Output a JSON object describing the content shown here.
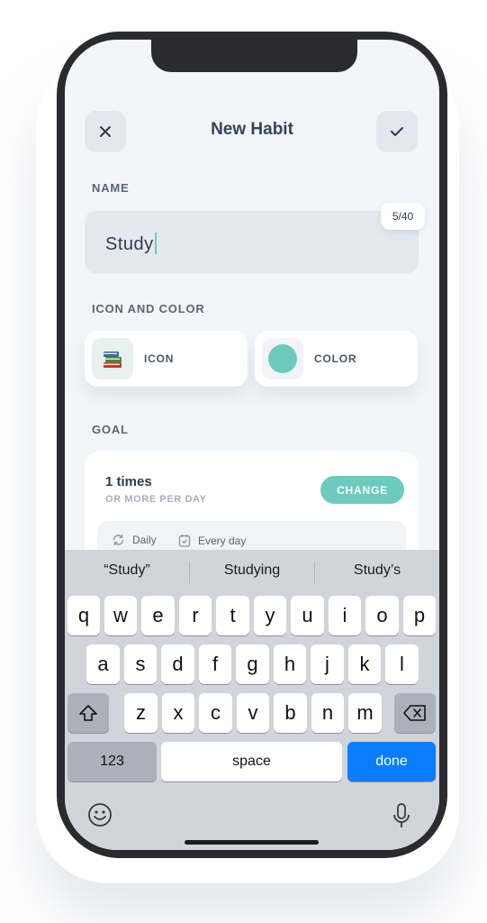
{
  "header": {
    "title": "New Habit"
  },
  "name_section": {
    "label": "NAME",
    "value": "Study",
    "counter": "5/40"
  },
  "icon_color_section": {
    "label": "ICON AND COLOR",
    "icon_label": "ICON",
    "color_label": "COLOR",
    "selected_color": "#6ccbbd",
    "selected_icon": "books-icon"
  },
  "goal_section": {
    "label": "GOAL",
    "times": "1 times",
    "subtitle": "OR MORE PER DAY",
    "change_label": "CHANGE",
    "frequency": "Daily",
    "schedule": "Every day"
  },
  "keyboard": {
    "suggestions": [
      "“Study”",
      "Studying",
      "Study’s"
    ],
    "row1": [
      "q",
      "w",
      "e",
      "r",
      "t",
      "y",
      "u",
      "i",
      "o",
      "p"
    ],
    "row2": [
      "a",
      "s",
      "d",
      "f",
      "g",
      "h",
      "j",
      "k",
      "l"
    ],
    "row3": [
      "z",
      "x",
      "c",
      "v",
      "b",
      "n",
      "m"
    ],
    "numbers_label": "123",
    "space_label": "space",
    "done_label": "done"
  },
  "colors": {
    "accent": "#6ccbbd",
    "keyboard_blue": "#0a7cff",
    "text_dark": "#2c3a52"
  }
}
